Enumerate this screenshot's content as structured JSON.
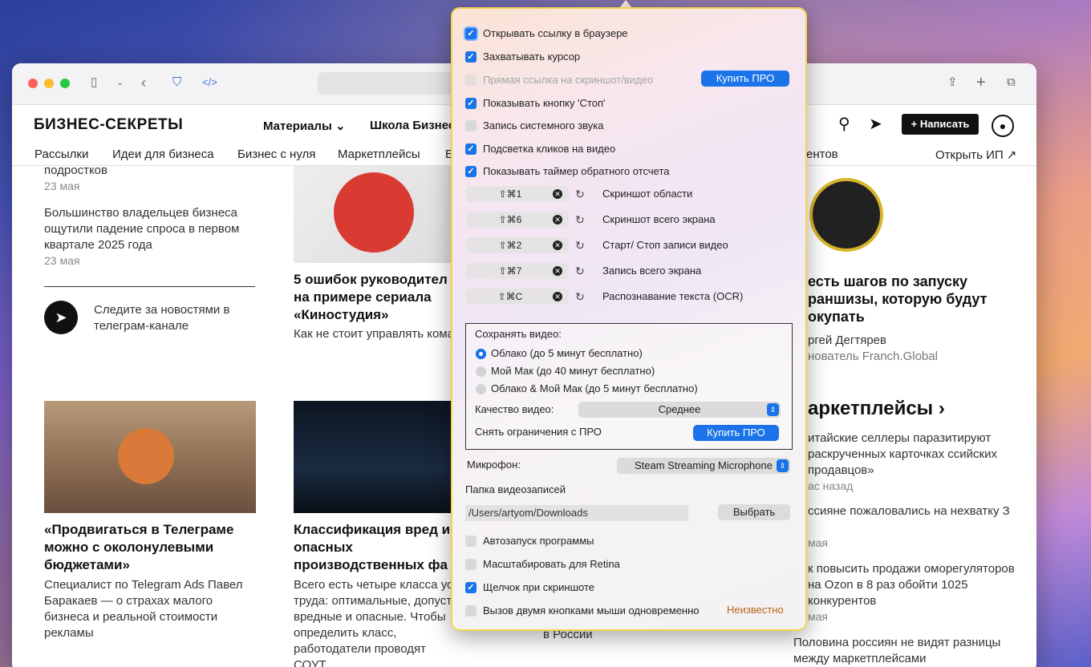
{
  "browser": {
    "site_logo": "БИЗНЕС-СЕКРЕТЫ",
    "nav": {
      "materials": "Материалы ⌄",
      "school": "Школа Бизнес",
      "write": "+ Написать"
    },
    "subnav": [
      "Рассылки",
      "Идеи для бизнеса",
      "Бизнес с нуля",
      "Маркетплейсы",
      "Б",
      "ентов",
      "Открыть ИП ↗"
    ],
    "left_col": {
      "item1_tail": "подростков",
      "item1_date": "23 мая",
      "item2": "Большинство владельцев бизнеса ощутили падение спроса в первом квартале 2025 года",
      "item2_date": "23 мая",
      "telegram": "Следите за новостями в телеграм-канале",
      "article_title": "«Продвигаться в Телеграме можно с околонулевыми бюджетами»",
      "article_text": "Специалист по Telegram Ads Павел Баракаев — о страхах малого бизнеса и реальной стоимости рекламы"
    },
    "mid_col": {
      "article1_title": "5 ошибок руководител на примере сериала «Киностудия»",
      "article1_text": "Как не стоит управлять кома",
      "article2_title": "Классификация вред и опасных производственных фа",
      "article2_text": "Всего есть четыре класса ус труда: оптимальные, допуст вредные и опасные. Чтобы определить класс, работодатели проводят СОУТ",
      "hidden_tail": "в России"
    },
    "right_col": {
      "feature_title": "есть шагов по запуску раншизы, которую будут окупать",
      "author": "ргей Дегтярев",
      "author_role": "нователь Franch.Global",
      "section": "аркетплейсы ›",
      "news1": "итайские селлеры паразитируют раскрученных карточках ссийских продавцов»",
      "news1_date": "ас назад",
      "news2": "ссияне пожаловались на нехватку З",
      "news2_date": "мая",
      "news3": "к повысить продажи оморегуляторов на Ozon в 8 раз обойти 1025 конкурентов",
      "news3_date": "мая",
      "news4": "Половина россиян не видят разницы между маркетплейсами"
    }
  },
  "popup": {
    "options": [
      {
        "label": "Открывать ссылку в браузере",
        "checked": true
      },
      {
        "label": "Захватывать курсор",
        "checked": true
      },
      {
        "label": "Прямая ссылка на скриншот/видео",
        "checked": false,
        "disabled": true
      },
      {
        "label": "Показывать кнопку 'Стоп'",
        "checked": true
      },
      {
        "label": "Запись системного звука",
        "checked": false
      },
      {
        "label": "Подсветка кликов на видео",
        "checked": true
      },
      {
        "label": "Показывать таймер обратного отсчета",
        "checked": true
      }
    ],
    "buy_pro": "Купить ПРО",
    "hotkeys": [
      {
        "keys": "⇧⌘1",
        "label": "Скриншот области"
      },
      {
        "keys": "⇧⌘6",
        "label": "Скриншот всего экрана"
      },
      {
        "keys": "⇧⌘2",
        "label": "Старт/ Стоп записи видео"
      },
      {
        "keys": "⇧⌘7",
        "label": "Запись всего экрана"
      },
      {
        "keys": "⇧⌘C",
        "label": "Распознавание текста (OCR)"
      }
    ],
    "save_video": {
      "title": "Сохранять видео:",
      "options": [
        "Облако (до 5 минут бесплатно)",
        "Мой Мак (до 40 минут бесплатно)",
        "Облако & Мой Мак (до 5 минут бесплатно)"
      ],
      "selected": 0,
      "quality_label": "Качество видео:",
      "quality_value": "Среднее",
      "unlock_label": "Снять ограничения с ПРО",
      "unlock_button": "Купить ПРО"
    },
    "mic_label": "Микрофон:",
    "mic_value": "Steam Streaming Microphone",
    "folder_label": "Папка видеозаписей",
    "folder_path": "/Users/artyom/Downloads",
    "folder_button": "Выбрать",
    "bottom_options": [
      {
        "label": "Автозапуск программы",
        "checked": false
      },
      {
        "label": "Масштабировать для Retina",
        "checked": false
      },
      {
        "label": "Щелчок при скриншоте",
        "checked": true
      },
      {
        "label": "Вызов двумя кнопками мыши одновременно",
        "checked": false
      }
    ],
    "unknown_status": "Неизвестно",
    "colors": {
      "accent": "#1a73e8",
      "border": "#f5d34a",
      "status": "#b5651d"
    }
  }
}
